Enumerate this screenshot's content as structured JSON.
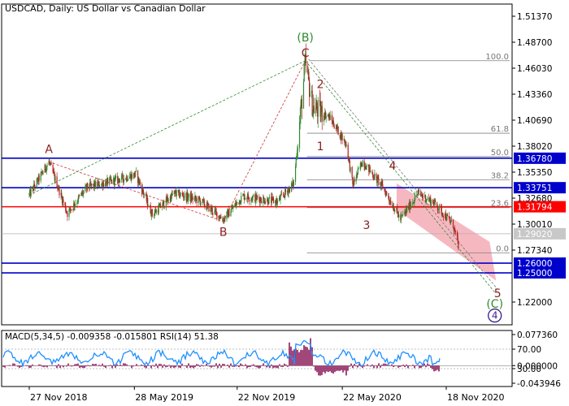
{
  "header": {
    "title": "USDCAD, Daily:  US Dollar vs Canadian Dollar"
  },
  "colors": {
    "background": "#ffffff",
    "candle_up": "#2e8b2e",
    "candle_down": "#b22222",
    "support_resistance_blue": "#0000cc",
    "level_red": "#ff0000",
    "wave_label": "#8b2020",
    "green_label": "#2e8b2e",
    "purple_label": "#3a1f8f",
    "projection_zone": "#f4a6b0",
    "macd_hist": "#8b1a5a",
    "rsi_line": "#1e90ff"
  },
  "chart_data": [
    {
      "type": "line",
      "name": "USDCAD Daily price",
      "title": "USDCAD, Daily:  US Dollar vs Canadian Dollar",
      "x_ticks": [
        "27 Nov 2018",
        "28 May 2019",
        "22 Nov 2019",
        "22 May 2020",
        "18 Nov 2020"
      ],
      "y_ticks": [
        1.5137,
        1.487,
        1.4603,
        1.4336,
        1.4069,
        1.3802,
        1.3535,
        1.3268,
        1.3001,
        1.2734,
        1.22
      ],
      "ylim": [
        1.196,
        1.523
      ],
      "close_path": {
        "x": [
          "2018-11-27",
          "2018-12-31",
          "2019-02-01",
          "2019-03-07",
          "2019-04-25",
          "2019-05-31",
          "2019-06-28",
          "2019-08-06",
          "2019-09-19",
          "2019-10-29",
          "2019-12-02",
          "2020-01-31",
          "2020-02-28",
          "2020-03-19",
          "2020-04-01",
          "2020-04-30",
          "2020-05-29",
          "2020-06-09",
          "2020-06-26",
          "2020-07-31",
          "2020-08-31",
          "2020-09-30",
          "2020-10-30",
          "2020-11-30",
          "2020-12-09"
        ],
        "y": [
          1.33,
          1.364,
          1.311,
          1.338,
          1.345,
          1.351,
          1.31,
          1.332,
          1.324,
          1.305,
          1.329,
          1.323,
          1.342,
          1.465,
          1.42,
          1.41,
          1.382,
          1.34,
          1.365,
          1.338,
          1.305,
          1.332,
          1.321,
          1.299,
          1.278
        ]
      },
      "levels": [
        {
          "value": 1.3678,
          "label": "1.36780",
          "style": "blue"
        },
        {
          "value": 1.33751,
          "label": "1.33751",
          "style": "blue"
        },
        {
          "value": 1.31794,
          "label": "1.31794",
          "style": "red"
        },
        {
          "value": 1.2902,
          "label": "1.29020",
          "style": "current"
        },
        {
          "value": 1.26,
          "label": "1.26000",
          "style": "blue"
        },
        {
          "value": 1.25,
          "label": "1.25000",
          "style": "blue"
        }
      ],
      "fibonacci": [
        {
          "label": "100.0",
          "value": 1.468
        },
        {
          "label": "61.8",
          "value": 1.3935
        },
        {
          "label": "50.0",
          "value": 1.3695
        },
        {
          "label": "38.2",
          "value": 1.3455
        },
        {
          "label": "23.6",
          "value": 1.317
        },
        {
          "label": "0.0",
          "value": 1.2705
        }
      ],
      "wave_labels": [
        {
          "text": "A",
          "x": "2018-12-31",
          "y": 1.373,
          "color": "wave"
        },
        {
          "text": "B",
          "x": "2019-10-29",
          "y": 1.288,
          "color": "wave"
        },
        {
          "text": "(B)",
          "x": "2020-03-19",
          "y": 1.488,
          "color": "green"
        },
        {
          "text": "C",
          "x": "2020-03-19",
          "y": 1.472,
          "color": "wave"
        },
        {
          "text": "1",
          "x": "2020-04-14",
          "y": 1.376,
          "color": "wave"
        },
        {
          "text": "2",
          "x": "2020-04-14",
          "y": 1.44,
          "color": "wave"
        },
        {
          "text": "3",
          "x": "2020-07-03",
          "y": 1.295,
          "color": "wave"
        },
        {
          "text": "4",
          "x": "2020-08-17",
          "y": 1.356,
          "color": "wave"
        },
        {
          "text": "5",
          "x": "2021-02-15",
          "y": 1.225,
          "color": "wave"
        },
        {
          "text": "(C)",
          "x": "2021-02-10",
          "y": 1.214,
          "color": "green"
        },
        {
          "text": "4",
          "x": "2021-02-10",
          "y": 1.202,
          "color": "purple_circle"
        }
      ]
    },
    {
      "type": "line",
      "name": "MACD and RSI",
      "header": "MACD(5,34,5) -0.009358 -0.015801 RSI(14) 51.38",
      "y_tick_labels": [
        "0.077360",
        "70.00",
        "0.000000",
        "30.00",
        "-0.043946"
      ],
      "rsi_levels": [
        70,
        30
      ],
      "macd_range": [
        -0.043946,
        0.07736
      ],
      "rsi_value": 51.38,
      "macd_value": -0.009358,
      "macd_signal": -0.015801
    }
  ]
}
